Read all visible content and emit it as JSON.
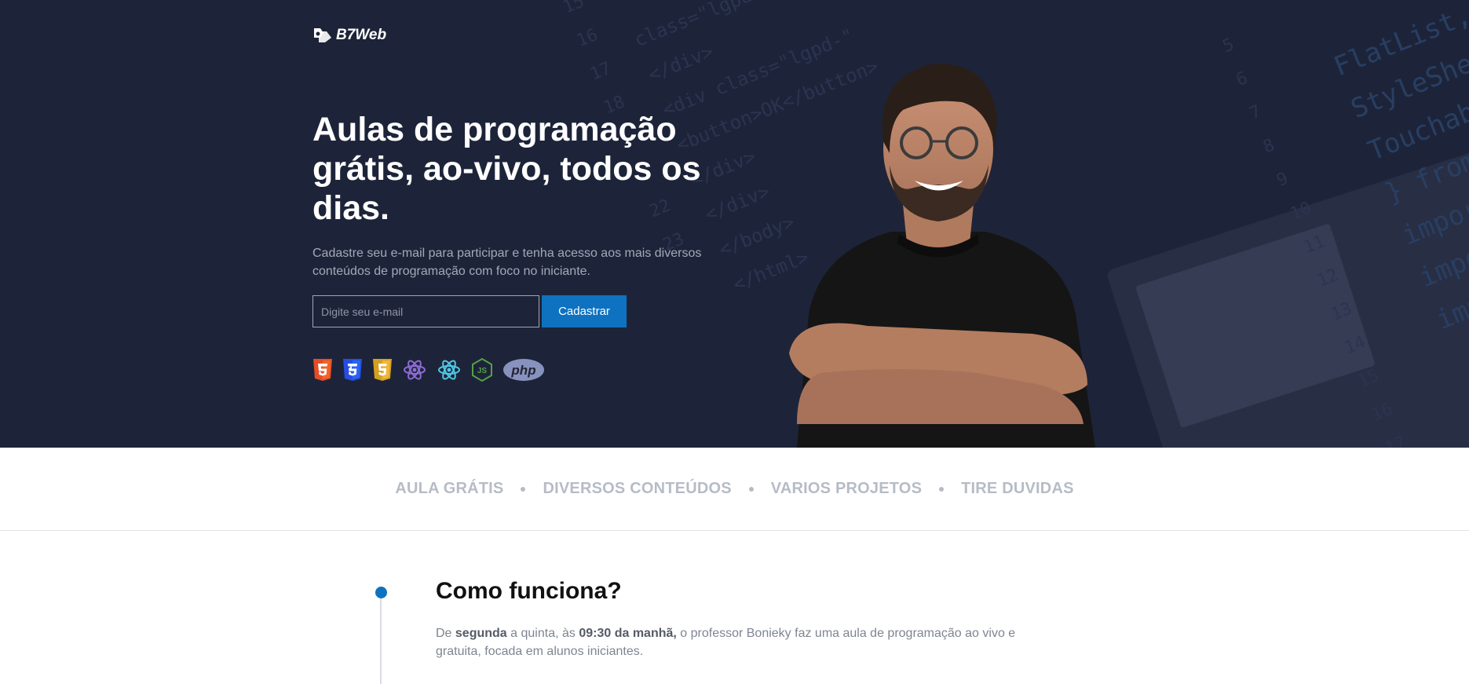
{
  "brand": {
    "logo_text": "B7Web",
    "logo_icon": "b7web-logo-icon"
  },
  "hero": {
    "title": "Aulas de programação grátis, ao-vivo, todos os dias.",
    "subtitle": "Cadastre seu e-mail para participar e tenha acesso aos mais diversos conteúdos de programação com foco no iniciante.",
    "email_placeholder": "Digite seu e-mail",
    "email_value": "",
    "submit_label": "Cadastrar",
    "background_code": "class=\"lgpd-\"\n</div>\n<div class=\"lgpd-\"\n<button>OK</button>\n</div>\n</div>\n</body>\n</html>",
    "background_code_right": "FlatList,\nStyleShee\nTouchabl\n} from '\nimport {\nimport\nimport",
    "background_line_numbers": "15\n16\n17\n18",
    "background_line_numbers_2": "22\n23",
    "background_line_numbers_3": "5\n6\n7\n8\n9\n10\n11\n12\n13\n14\n15\n16\n17",
    "tech_icons": [
      "html5-icon",
      "css3-icon",
      "javascript-icon",
      "redux-icon",
      "react-icon",
      "nodejs-icon",
      "php-icon"
    ],
    "php_label": "php",
    "js_label": "JS",
    "accent_color": "#0e72c0",
    "background_color": "#1d2439"
  },
  "features": {
    "items": [
      "AULA GRÁTIS",
      "DIVERSOS CONTEÚDOS",
      "VARIOS PROJETOS",
      "TIRE DUVIDAS"
    ]
  },
  "how": {
    "title": "Como funciona?",
    "text_parts": {
      "p1": "De ",
      "b1": "segunda",
      "p2": " a quinta, às ",
      "b2": "09:30 da manhã,",
      "p3": " o professor Bonieky faz uma aula de programação ao vivo e gratuita, focada em alunos iniciantes."
    }
  }
}
